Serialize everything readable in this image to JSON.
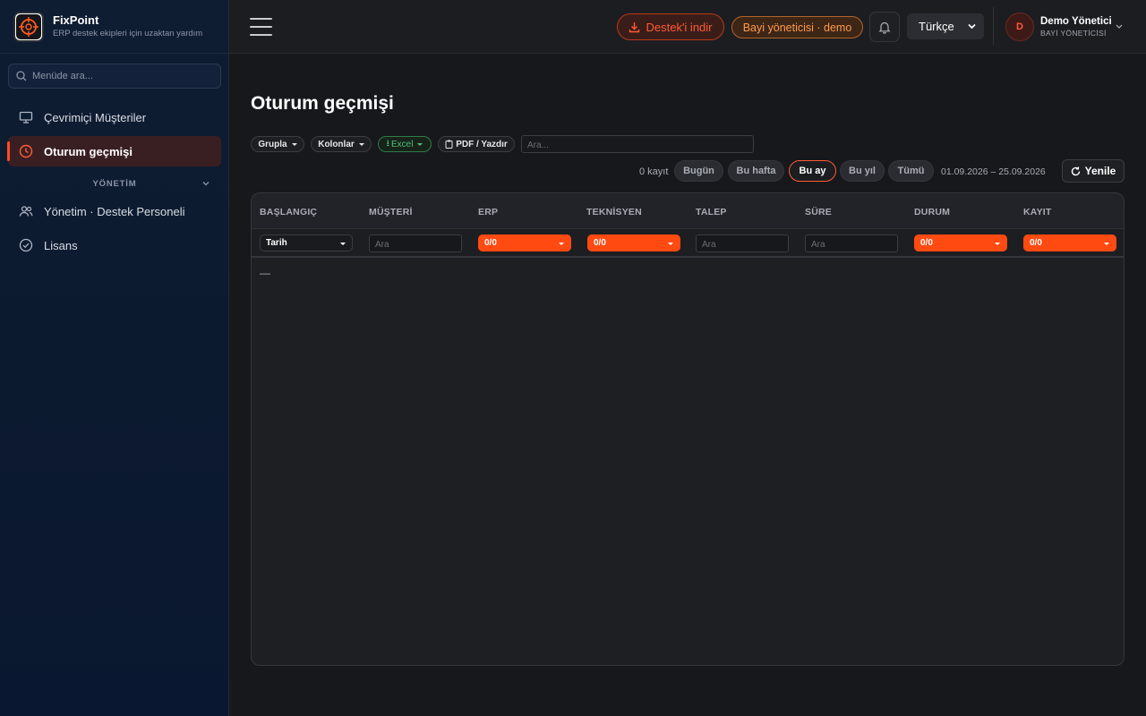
{
  "brand": {
    "name": "FixPoint",
    "tagline": "ERP destek ekipleri için uzaktan yardım",
    "logo_text": "FixPoint"
  },
  "sidebar": {
    "search_placeholder": "Menüde ara...",
    "items": [
      {
        "label": "Çevrimiçi Müşteriler",
        "icon": "monitor-icon",
        "active": false
      },
      {
        "label": "Oturum geçmişi",
        "icon": "clock-icon",
        "active": true
      }
    ],
    "section": {
      "label": "YÖNETİM"
    },
    "section_items": [
      {
        "label": "Yönetim · Destek Personeli",
        "icon": "users-icon"
      },
      {
        "label": "Lisans",
        "icon": "check-circle-icon"
      }
    ]
  },
  "topbar": {
    "download_label": "Destek'i indir",
    "role_badge": "Bayi yöneticisi · demo",
    "language": "Türkçe",
    "user": {
      "initial": "D",
      "name": "Demo Yönetici",
      "role": "BAYİ YÖNETİCİSİ"
    }
  },
  "page": {
    "title": "Oturum geçmişi"
  },
  "toolbar": {
    "group_label": "Grupla",
    "columns_label": "Kolonlar",
    "excel_label": "Excel",
    "pdf_label": "PDF / Yazdır",
    "search_placeholder": "Ara..."
  },
  "filters": {
    "count_text": "0 kayıt",
    "periods": [
      {
        "label": "Bugün",
        "active": false
      },
      {
        "label": "Bu hafta",
        "active": false
      },
      {
        "label": "Bu ay",
        "active": true
      },
      {
        "label": "Bu yıl",
        "active": false
      },
      {
        "label": "Tümü",
        "active": false
      }
    ],
    "date_range": "01.09.2026 – 25.09.2026",
    "refresh_label": "Yenile"
  },
  "table": {
    "columns": [
      "BAŞLANGIÇ",
      "MÜŞTERİ",
      "ERP",
      "TEKNİSYEN",
      "TALEP",
      "SÜRE",
      "DURUM",
      "KAYIT"
    ],
    "filter_row": {
      "date_select": "Tarih",
      "customer_placeholder": "Ara",
      "erp_select": "0/0",
      "tech_select": "0/0",
      "request_placeholder": "Ara",
      "duration_placeholder": "Ara",
      "status_select": "0/0",
      "record_select": "0/0"
    },
    "empty_text": "—"
  },
  "colors": {
    "accent": "#ff4a12",
    "sidebar_bg": "#0c1a30",
    "main_bg": "#17181c"
  }
}
